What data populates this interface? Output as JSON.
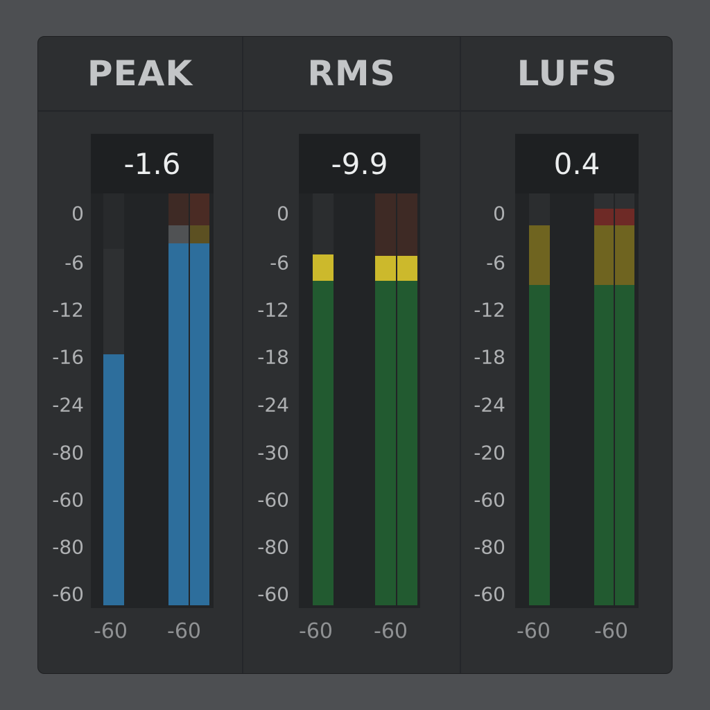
{
  "meters": [
    {
      "title": "PEAK",
      "readout": "-1.6",
      "scale": [
        "0",
        "-6",
        "-12",
        "-16",
        "-24",
        "-80",
        "-60",
        "-80",
        "-60"
      ],
      "footer": [
        "-60",
        "-60"
      ],
      "channels": [
        {
          "level": 0.61,
          "peak_hold": 0.87,
          "fill_color": "#2d6e9c"
        },
        {
          "level": 0.88,
          "peak_hold": 0.95,
          "fill_color": "#2d6e9c"
        },
        {
          "level": 0.88,
          "peak_hold": 0.95,
          "fill_color": "#2d6e9c"
        }
      ]
    },
    {
      "title": "RMS",
      "readout": "-9.9",
      "scale": [
        "0",
        "-6",
        "-12",
        "-18",
        "-24",
        "-30",
        "-60",
        "-80",
        "-60"
      ],
      "footer": [
        "-60",
        "-60"
      ],
      "channels": [
        {
          "level": 0.79,
          "peak_hold": 0.85,
          "fill_color": "#225a30"
        },
        {
          "level": 0.79,
          "peak_hold": 0.85,
          "fill_color": "#225a30"
        },
        {
          "level": 0.79,
          "peak_hold": 0.85,
          "fill_color": "#225a30"
        }
      ]
    },
    {
      "title": "LUFS",
      "readout": "0.4",
      "scale": [
        "0",
        "-6",
        "-12",
        "-18",
        "-24",
        "-20",
        "-60",
        "-80",
        "-60"
      ],
      "footer": [
        "-60",
        "-60"
      ],
      "channels": [
        {
          "level": 0.78,
          "peak_hold": 0.92,
          "fill_color": "#225a30"
        },
        {
          "level": 0.78,
          "peak_hold": 0.96,
          "fill_color": "#225a30"
        },
        {
          "level": 0.78,
          "peak_hold": 0.96,
          "fill_color": "#225a30"
        }
      ]
    }
  ],
  "colors": {
    "panel": "#2d2f31",
    "background": "#4d4f52",
    "bar_empty": "#1c1d1f",
    "yellow": "#ccb92c",
    "yellow_dim": "#6f6420",
    "red_dim": "#4a2b24",
    "red": "#6e2a26"
  }
}
